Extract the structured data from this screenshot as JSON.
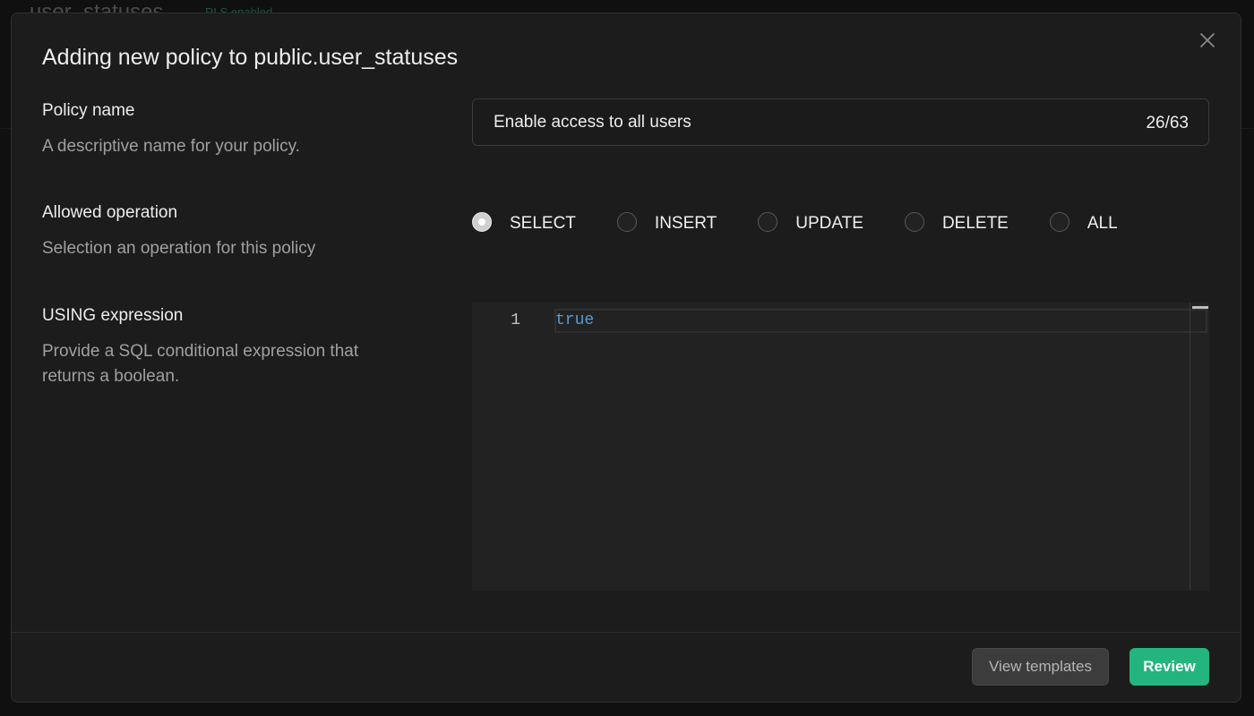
{
  "background_page": {
    "table_title": "user_statuses",
    "rls_badge": "RLS enabled"
  },
  "icons": {
    "close": "close-icon"
  },
  "modal": {
    "title": "Adding new policy to public.user_statuses",
    "policy_name": {
      "label": "Policy name",
      "description": "A descriptive name for your policy.",
      "value": "Enable access to all users",
      "char_count": "26/63"
    },
    "allowed_operation": {
      "label": "Allowed operation",
      "description": "Selection an operation for this policy",
      "options": [
        {
          "label": "SELECT",
          "checked": true
        },
        {
          "label": "INSERT",
          "checked": false
        },
        {
          "label": "UPDATE",
          "checked": false
        },
        {
          "label": "DELETE",
          "checked": false
        },
        {
          "label": "ALL",
          "checked": false
        }
      ]
    },
    "using_expression": {
      "label": "USING expression",
      "description": "Provide a SQL conditional expression that returns a boolean.",
      "editor": {
        "lines": [
          {
            "number": "1",
            "code": "true"
          }
        ]
      }
    },
    "footer": {
      "view_templates_label": "View templates",
      "review_label": "Review"
    }
  },
  "colors": {
    "accent": "#24b47e",
    "code_keyword": "#569cd6"
  }
}
